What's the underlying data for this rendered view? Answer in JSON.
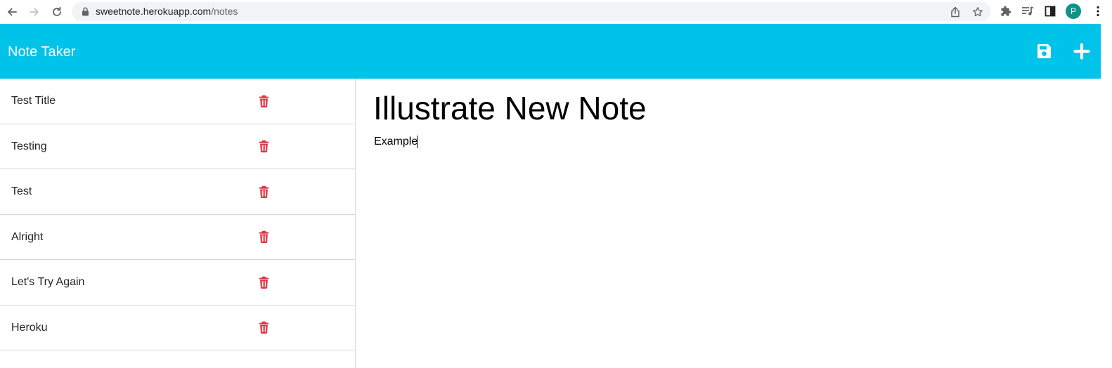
{
  "browser": {
    "url_host": "sweetnote.herokuapp.com",
    "url_path": "/notes",
    "profile_initial": "P",
    "icons": [
      "back-arrow-icon",
      "forward-arrow-icon",
      "reload-icon",
      "lock-icon",
      "share-icon",
      "star-icon",
      "puzzle-icon",
      "media-control-icon",
      "side-panel-icon",
      "kebab-menu-icon"
    ]
  },
  "navbar": {
    "title": "Note Taker",
    "icons": [
      "save-icon",
      "plus-icon"
    ],
    "background_color": "#00c3ea"
  },
  "notes": [
    {
      "title": "Test Title"
    },
    {
      "title": "Testing"
    },
    {
      "title": "Test"
    },
    {
      "title": "Alright"
    },
    {
      "title": "Let's Try Again"
    },
    {
      "title": "Heroku"
    }
  ],
  "delete_icon": {
    "name": "trash-icon",
    "color": "#dc3545"
  },
  "editor": {
    "title_value": "Illustrate New Note",
    "body_value": "Example"
  }
}
